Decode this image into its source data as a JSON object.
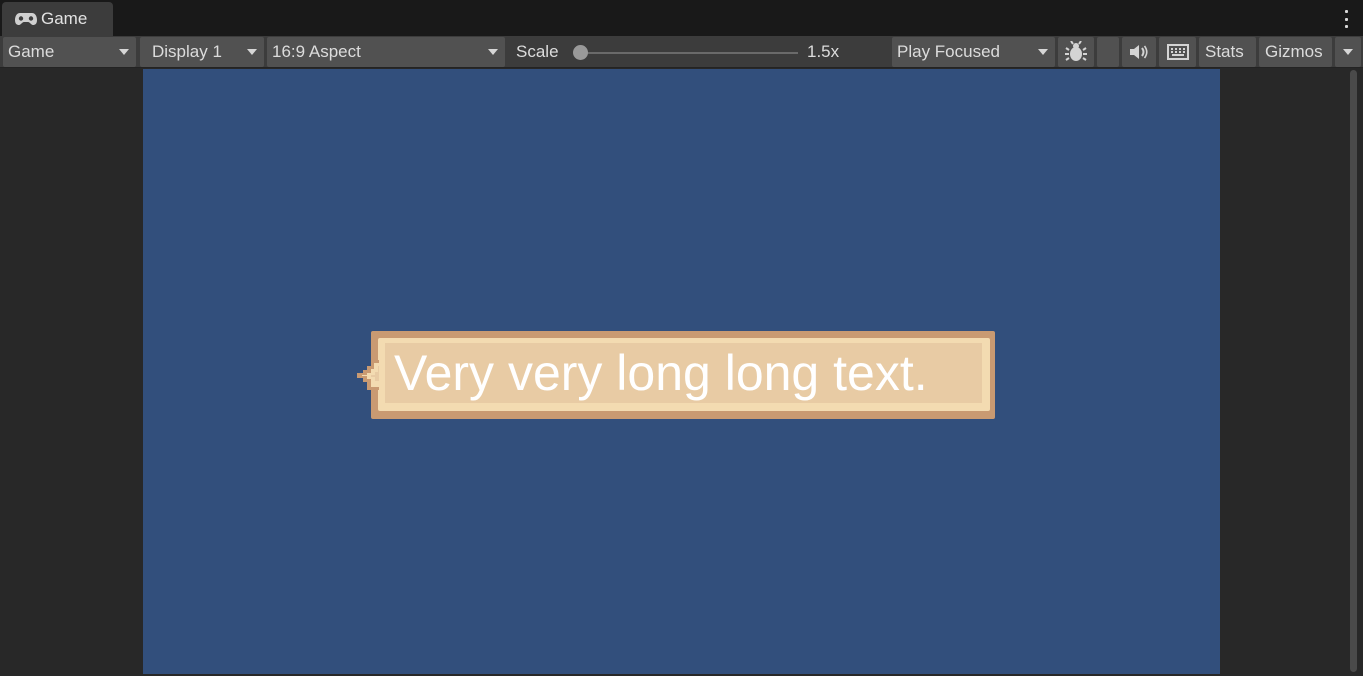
{
  "window": {
    "tab_label": "Game",
    "tab_icon": "gamepad-icon"
  },
  "toolbar": {
    "view_dropdown": "Game",
    "display_dropdown": "Display 1",
    "aspect_dropdown": "16:9 Aspect",
    "scale_label": "Scale",
    "scale_value": "1.5x",
    "play_mode_dropdown": "Play Focused",
    "stats_label": "Stats",
    "gizmos_label": "Gizmos",
    "icons": [
      "bug-icon",
      "speaker-icon",
      "keyboard-icon",
      "chevron-down-icon"
    ]
  },
  "game": {
    "speech_text": "Very very long long text."
  },
  "colors": {
    "game_background": "#324f7c",
    "bubble_fill": "#e8cba4",
    "bubble_border": "#c99a72",
    "bubble_highlight": "#f3dbb1",
    "text": "#ffffff"
  }
}
